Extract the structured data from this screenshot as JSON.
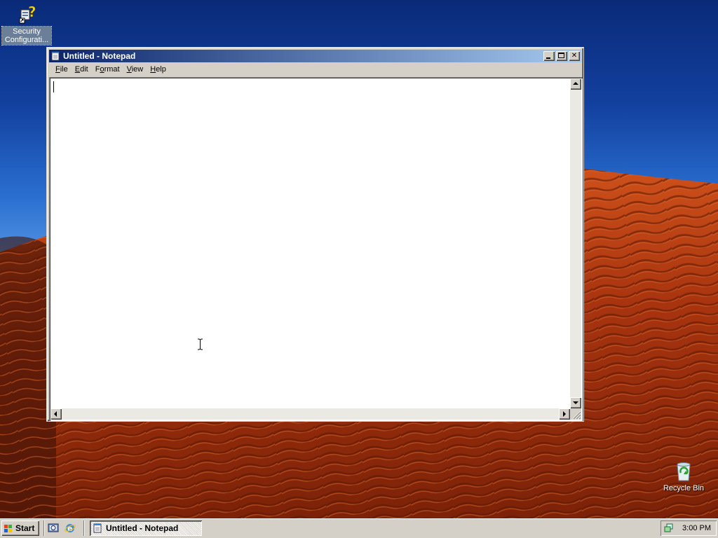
{
  "desktop": {
    "icons": [
      {
        "label": "Security Configurati...",
        "icon": "security-configuration-icon"
      },
      {
        "label": "Recycle Bin",
        "icon": "recycle-bin-icon"
      }
    ]
  },
  "window": {
    "title": "Untitled - Notepad",
    "menu": [
      "File",
      "Edit",
      "Format",
      "View",
      "Help"
    ],
    "menu_hotkeys": [
      "F",
      "E",
      "o",
      "V",
      "H"
    ],
    "content": ""
  },
  "taskbar": {
    "start_label": "Start",
    "quick_launch": [
      "show-desktop-icon",
      "internet-explorer-icon"
    ],
    "tasks": [
      {
        "label": "Untitled - Notepad",
        "active": true
      }
    ],
    "clock": "3:00 PM"
  },
  "colors": {
    "title_active_start": "#0a246a",
    "title_active_end": "#a6caf0",
    "face": "#d4d0c8",
    "sky_top": "#0a2a78",
    "dune": "#b03a12"
  }
}
